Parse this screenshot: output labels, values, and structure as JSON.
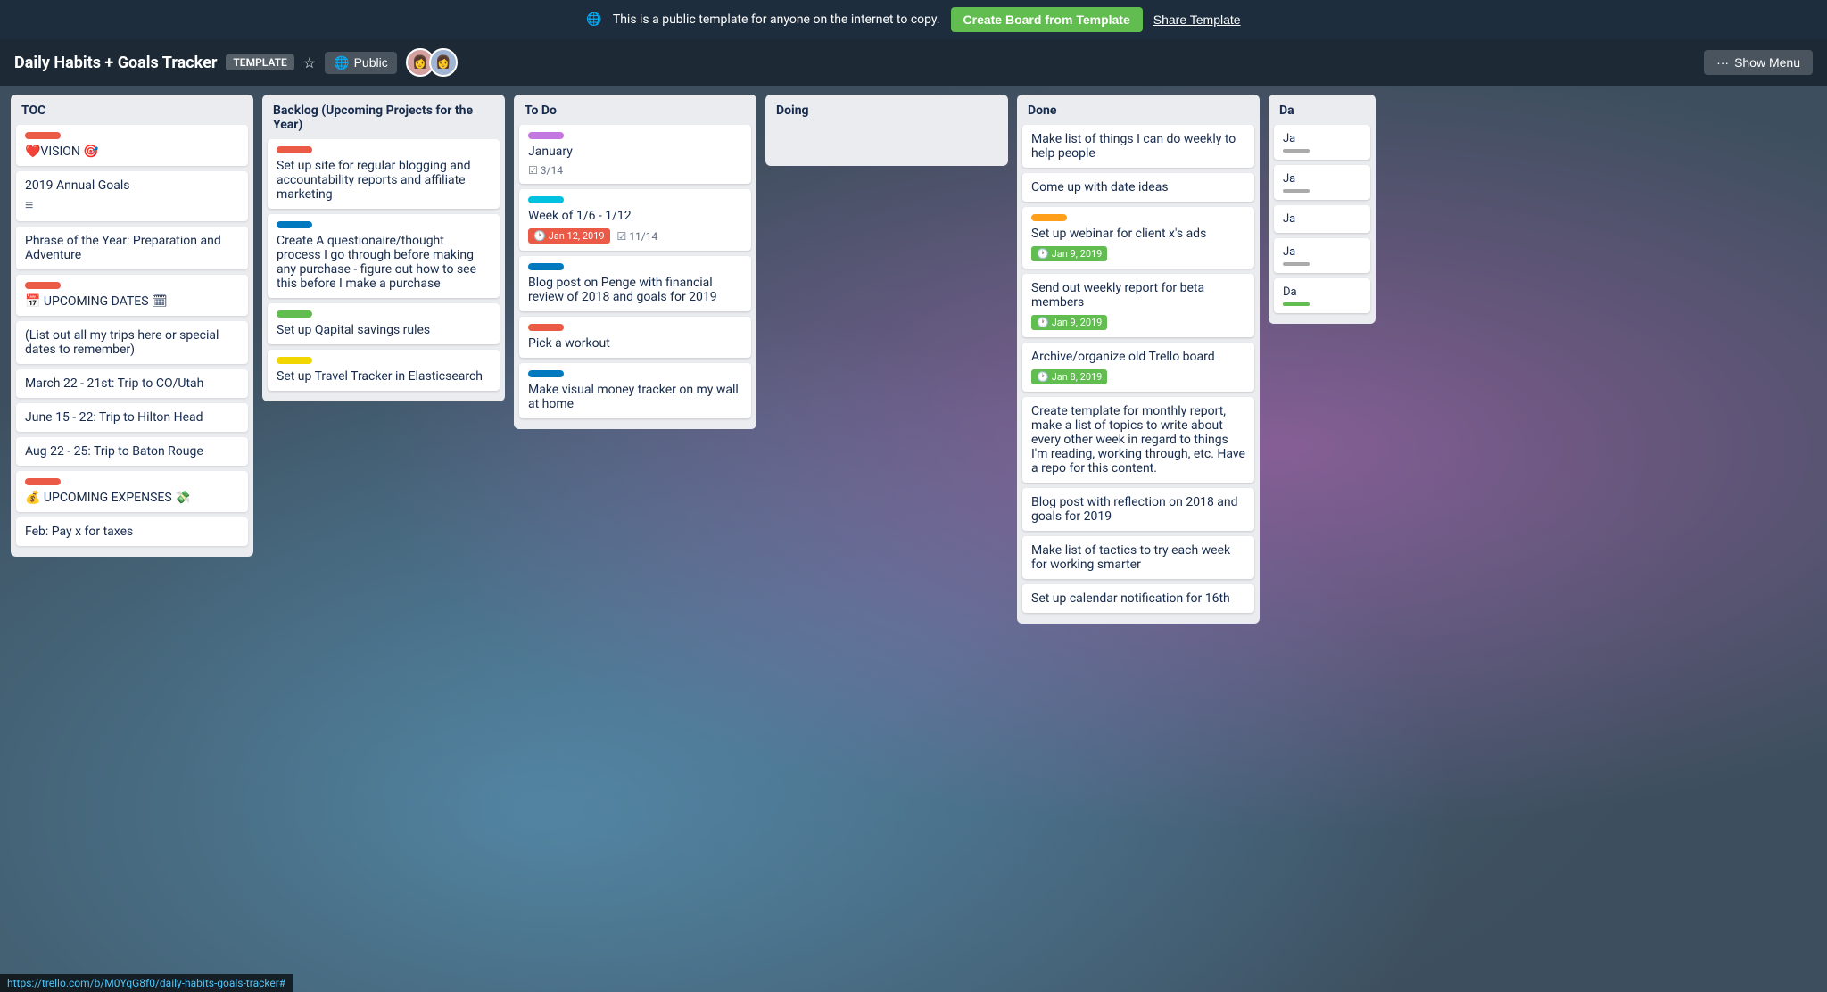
{
  "notification": {
    "text": "This is a public template for anyone on the internet to copy.",
    "globe_icon": "🌐",
    "create_btn": "Create Board from Template",
    "share_btn": "Share Template"
  },
  "board": {
    "title": "Daily Habits + Goals Tracker",
    "badge": "TEMPLATE",
    "visibility": "Public",
    "show_menu": "Show Menu"
  },
  "lists": [
    {
      "id": "toc",
      "title": "TOC",
      "items": [
        {
          "label_color": "red",
          "text": "❤️VISION 🎯",
          "has_label": true
        },
        {
          "text": "2019 Annual Goals",
          "has_align_icon": true
        },
        {
          "text": "Phrase of the Year: Preparation and Adventure"
        },
        {
          "label_color": "red",
          "text": "📅 UPCOMING DATES 🗓",
          "has_label": true
        },
        {
          "text": "(List out all my trips here or special dates to remember)"
        },
        {
          "text": "March 22 - 21st: Trip to CO/Utah"
        },
        {
          "text": "June 15 - 22: Trip to Hilton Head"
        },
        {
          "text": "Aug 22 - 25: Trip to Baton Rouge"
        },
        {
          "label_color": "red",
          "text": "💰 UPCOMING EXPENSES 💸",
          "has_label": true
        },
        {
          "text": "Feb: Pay x for taxes"
        }
      ]
    },
    {
      "id": "backlog",
      "title": "Backlog (Upcoming Projects for the Year)",
      "cards": [
        {
          "label_color": "red",
          "text": "Set up site for regular blogging and accountability reports and affiliate marketing"
        },
        {
          "label_color": "blue",
          "text": "Create A questionaire/thought process I go through before making any purchase - figure out how to see this before I make a purchase"
        },
        {
          "label_color": "green",
          "text": "Set up Qapital savings rules"
        },
        {
          "label_color": "yellow",
          "text": "Set up Travel Tracker in Elasticsearch"
        }
      ]
    },
    {
      "id": "todo",
      "title": "To Do",
      "cards": [
        {
          "label_color": "purple",
          "text": "January",
          "badges": [
            {
              "type": "checklist",
              "value": "3/14"
            }
          ]
        },
        {
          "label_color": "teal",
          "text": "Week of 1/6 - 1/12",
          "badges": [
            {
              "type": "due",
              "value": "Jan 12, 2019",
              "color": "red"
            },
            {
              "type": "checklist",
              "value": "11/14"
            }
          ]
        },
        {
          "label_color": "blue",
          "text": "Blog post on Penge with financial review of 2018 and goals for 2019"
        },
        {
          "label_color": "red",
          "text": "Pick a workout"
        },
        {
          "label_color": "blue",
          "text": "Make visual money tracker on my wall at home"
        }
      ]
    },
    {
      "id": "doing",
      "title": "Doing",
      "cards": []
    },
    {
      "id": "done",
      "title": "Done",
      "cards": [
        {
          "text": "Make list of things I can do weekly to help people"
        },
        {
          "text": "Come up with date ideas"
        },
        {
          "label_color": "orange",
          "text": "Set up webinar for client x's ads",
          "badges": [
            {
              "type": "due",
              "value": "Jan 9, 2019",
              "color": "green"
            }
          ]
        },
        {
          "text": "Send out weekly report for beta members",
          "badges": [
            {
              "type": "due",
              "value": "Jan 9, 2019",
              "color": "green"
            }
          ]
        },
        {
          "text": "Archive/organize old Trello board",
          "badges": [
            {
              "type": "due",
              "value": "Jan 8, 2019",
              "color": "green"
            }
          ]
        },
        {
          "text": "Create template for monthly report, make a list of topics to write about every other week in regard to things I'm reading, working through, etc. Have a repo for this content."
        },
        {
          "text": "Blog post with reflection on 2018 and goals for 2019"
        },
        {
          "text": "Make list of tactics to try each week for working smarter"
        },
        {
          "text": "Set up calendar notification for 16th"
        }
      ]
    },
    {
      "id": "da",
      "title": "Da",
      "cards": [
        {
          "text": "Ja"
        },
        {
          "text": "Ja"
        },
        {
          "text": "Ja"
        },
        {
          "text": "Ja"
        },
        {
          "text": "Da"
        }
      ]
    }
  ],
  "status_bar": {
    "url": "https://trello.com/b/M0YqG8f0/daily-habits-goals-tracker#"
  }
}
